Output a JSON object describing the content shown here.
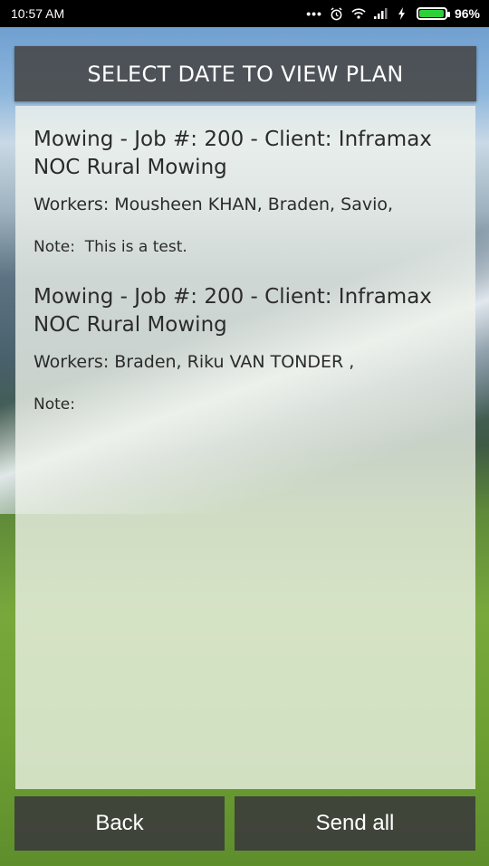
{
  "status_bar": {
    "time": "10:57 AM",
    "battery_percent": "96%",
    "battery_level": 0.96,
    "icons": [
      "more-dots-icon",
      "alarm-icon",
      "wifi-icon",
      "signal-icon",
      "charging-icon",
      "battery-icon"
    ]
  },
  "header": {
    "title": "SELECT DATE TO VIEW PLAN"
  },
  "jobs": [
    {
      "title": "Mowing - Job #: 200 - Client: Inframax NOC Rural Mowing",
      "workers": "Workers: Mousheen KHAN, Braden, Savio,",
      "note": "Note:  This is a test."
    },
    {
      "title": "Mowing - Job #: 200 - Client: Inframax NOC Rural Mowing",
      "workers": "Workers: Braden, Riku VAN TONDER  ,",
      "note": "Note:"
    }
  ],
  "buttons": {
    "back": "Back",
    "send_all": "Send all"
  },
  "colors": {
    "header_bg": "#464646",
    "button_bg": "#3c3c3c",
    "battery_fill": "#2fcf3a"
  }
}
